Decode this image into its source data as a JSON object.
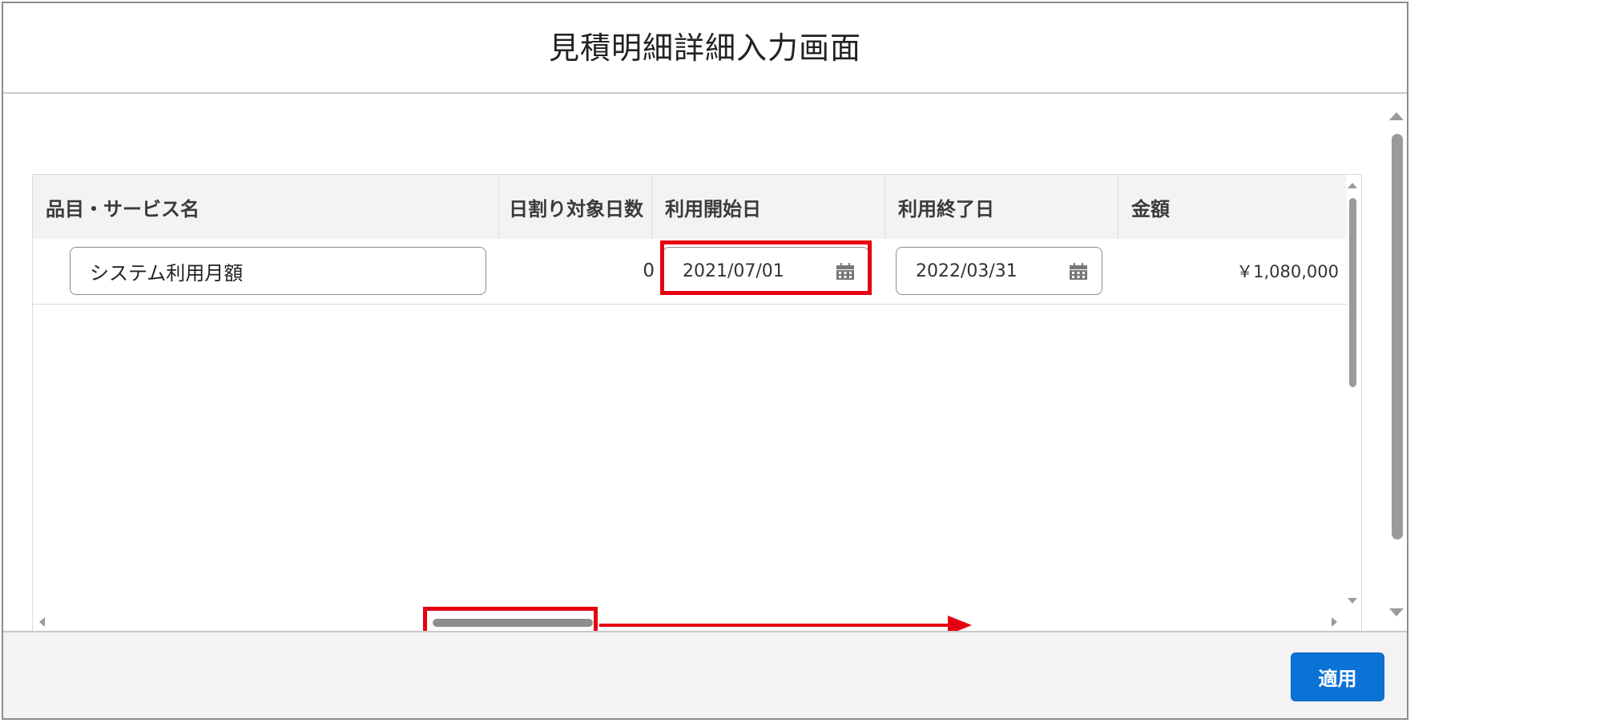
{
  "modal": {
    "title": "見積明細詳細入力画面"
  },
  "grid": {
    "columns": [
      "品目・サービス名",
      "日割り対象日数",
      "利用開始日",
      "利用終了日",
      "金額"
    ],
    "rows": [
      {
        "item_name": "システム利用月額",
        "prorated_days": "0",
        "start_date": "2021/07/01",
        "end_date": "2022/03/31",
        "amount": "￥1,080,000"
      }
    ]
  },
  "footer": {
    "apply_label": "適用"
  },
  "icons": {
    "calendar": "calendar-icon"
  },
  "colors": {
    "annotation": "#e60012",
    "primary_button": "#0b72d6"
  }
}
